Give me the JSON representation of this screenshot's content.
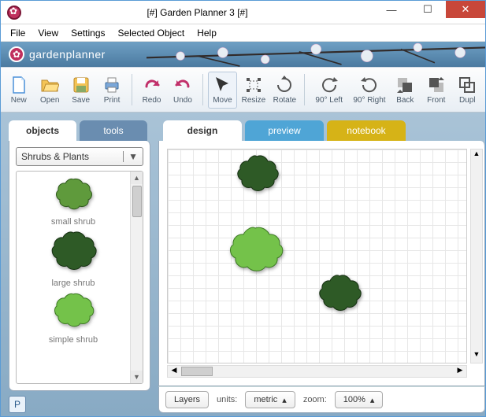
{
  "window": {
    "title": "[#] Garden Planner 3 [#]"
  },
  "menu": {
    "file": "File",
    "view": "View",
    "settings": "Settings",
    "selected": "Selected Object",
    "help": "Help"
  },
  "brand": {
    "name": "gardenplanner"
  },
  "toolbar": {
    "new": "New",
    "open": "Open",
    "save": "Save",
    "print": "Print",
    "redo": "Redo",
    "undo": "Undo",
    "move": "Move",
    "resize": "Resize",
    "rotate": "Rotate",
    "rot_left": "90° Left",
    "rot_right": "90° Right",
    "back": "Back",
    "front": "Front",
    "dupl": "Dupl"
  },
  "leftTabs": {
    "objects": "objects",
    "tools": "tools"
  },
  "objectsPanel": {
    "category": "Shrubs & Plants",
    "items": [
      {
        "label": "small shrub"
      },
      {
        "label": "large shrub"
      },
      {
        "label": "simple shrub"
      }
    ]
  },
  "rightTabs": {
    "design": "design",
    "preview": "preview",
    "notebook": "notebook"
  },
  "footer": {
    "layers": "Layers",
    "units_label": "units:",
    "units_value": "metric",
    "zoom_label": "zoom:",
    "zoom_value": "100%"
  },
  "badge": {
    "p": "P"
  }
}
